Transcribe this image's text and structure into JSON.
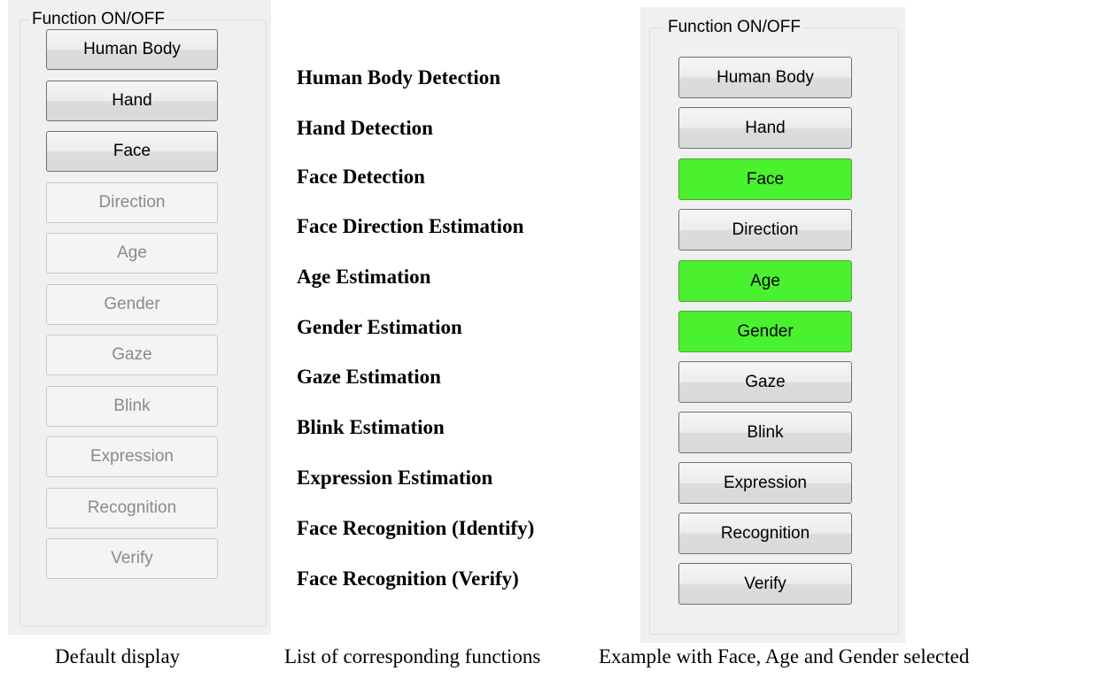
{
  "left_panel": {
    "group_title": "Function ON/OFF",
    "buttons": [
      {
        "label": "Human Body",
        "state": "enabled"
      },
      {
        "label": "Hand",
        "state": "enabled"
      },
      {
        "label": "Face",
        "state": "enabled"
      },
      {
        "label": "Direction",
        "state": "disabled"
      },
      {
        "label": "Age",
        "state": "disabled"
      },
      {
        "label": "Gender",
        "state": "disabled"
      },
      {
        "label": "Gaze",
        "state": "disabled"
      },
      {
        "label": "Blink",
        "state": "disabled"
      },
      {
        "label": "Expression",
        "state": "disabled"
      },
      {
        "label": "Recognition",
        "state": "disabled"
      },
      {
        "label": "Verify",
        "state": "disabled"
      }
    ]
  },
  "functions": [
    "Human Body Detection",
    "Hand Detection",
    "Face Detection",
    "Face Direction Estimation",
    "Age Estimation",
    "Gender Estimation",
    "Gaze Estimation",
    "Blink Estimation",
    "Expression Estimation",
    "Face Recognition (Identify)",
    "Face Recognition (Verify)"
  ],
  "right_panel": {
    "group_title": "Function ON/OFF",
    "buttons": [
      {
        "label": "Human Body",
        "state": "enabled"
      },
      {
        "label": "Hand",
        "state": "enabled"
      },
      {
        "label": "Face",
        "state": "selected"
      },
      {
        "label": "Direction",
        "state": "enabled"
      },
      {
        "label": "Age",
        "state": "selected"
      },
      {
        "label": "Gender",
        "state": "selected"
      },
      {
        "label": "Gaze",
        "state": "enabled"
      },
      {
        "label": "Blink",
        "state": "enabled"
      },
      {
        "label": "Expression",
        "state": "enabled"
      },
      {
        "label": "Recognition",
        "state": "enabled"
      },
      {
        "label": "Verify",
        "state": "enabled"
      }
    ]
  },
  "captions": {
    "left": "Default display",
    "middle": "List of corresponding functions",
    "right": "Example with Face, Age and Gender selected"
  },
  "colors": {
    "selected": "#49f12f",
    "panel_bg": "#f0f0f0",
    "disabled_text": "#8a8a8a"
  }
}
